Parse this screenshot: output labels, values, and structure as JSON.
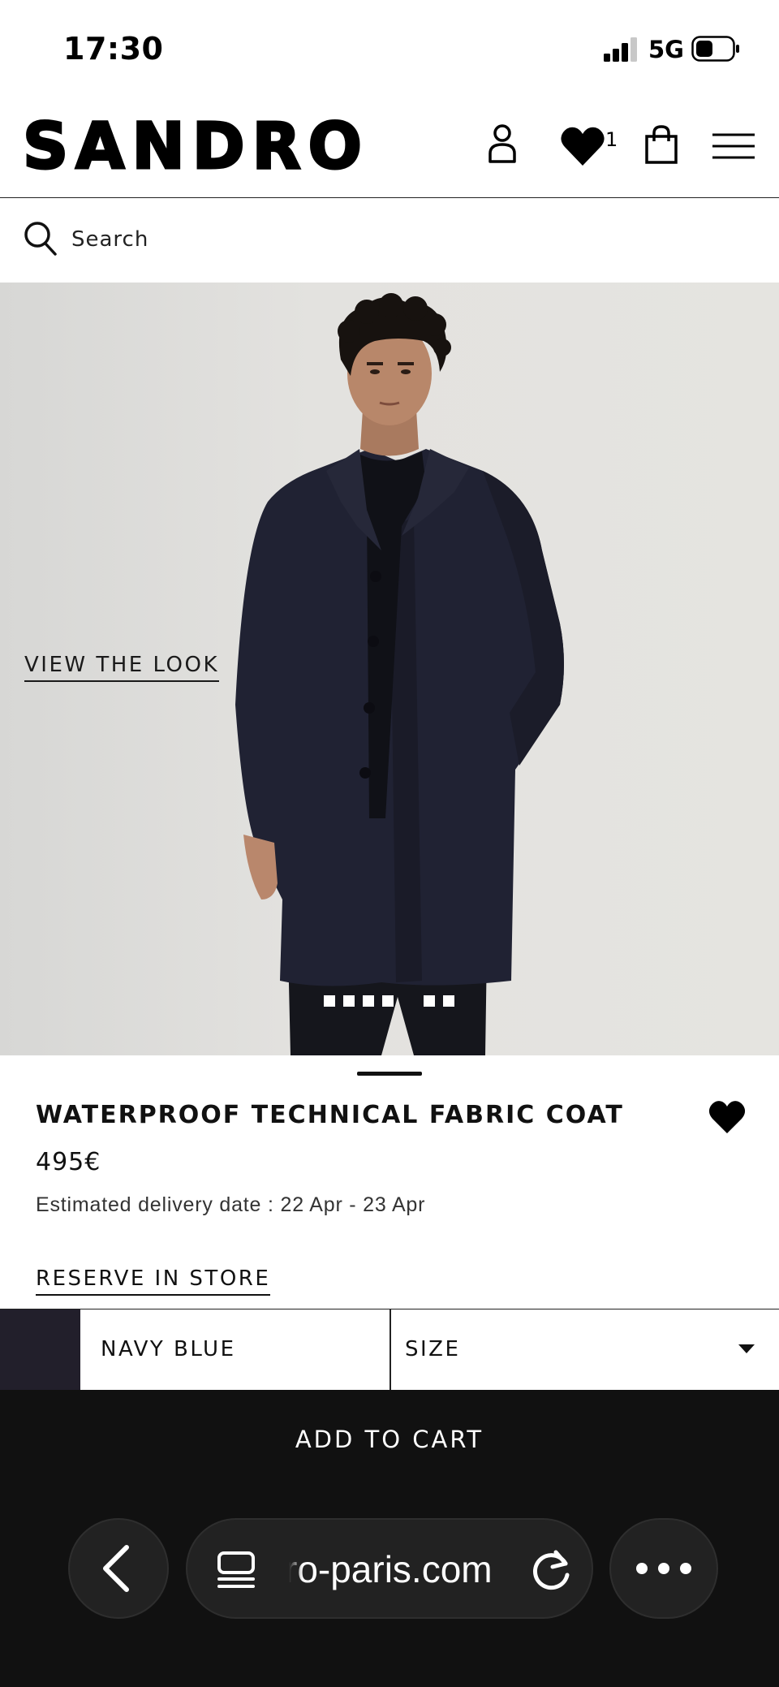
{
  "status_bar": {
    "time": "17:30",
    "network": "5G"
  },
  "header": {
    "logo": "SANDRO",
    "wishlist_count": "1"
  },
  "search": {
    "placeholder": "Search"
  },
  "gallery": {
    "view_look": "VIEW THE LOOK"
  },
  "product": {
    "name": "WATERPROOF TECHNICAL FABRIC COAT",
    "price": "495€",
    "delivery": "Estimated delivery date : 22 Apr - 23 Apr",
    "reserve": "RESERVE IN STORE"
  },
  "options": {
    "color_label": "NAVY BLUE",
    "color_hex": "#221f2b",
    "size_label": "SIZE"
  },
  "cart": {
    "add_label": "ADD TO CART"
  },
  "browser": {
    "url": "ro-paris.com"
  }
}
